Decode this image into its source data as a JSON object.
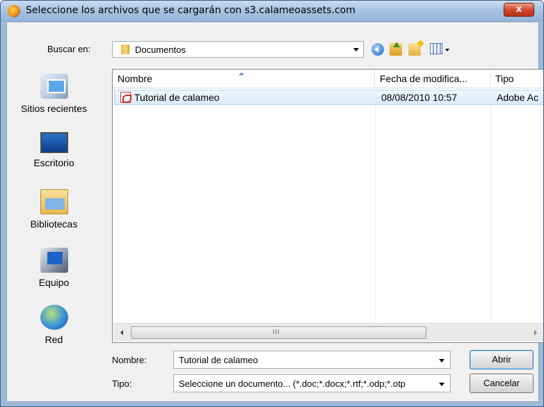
{
  "window": {
    "title": "Seleccione los archivos que se cargarán con s3.calameoassets.com",
    "close_label": "x"
  },
  "lookin": {
    "label": "Buscar en:",
    "value": "Documentos"
  },
  "toolbar": {
    "icons": [
      "back-icon",
      "up-folder-icon",
      "new-folder-icon",
      "views-icon"
    ]
  },
  "places": [
    {
      "label": "Sitios recientes",
      "icon": "recent-places-icon"
    },
    {
      "label": "Escritorio",
      "icon": "desktop-icon"
    },
    {
      "label": "Bibliotecas",
      "icon": "libraries-icon"
    },
    {
      "label": "Equipo",
      "icon": "computer-icon"
    },
    {
      "label": "Red",
      "icon": "network-icon"
    }
  ],
  "filelist": {
    "columns": [
      "Nombre",
      "Fecha de modifica...",
      "Tipo"
    ],
    "rows": [
      {
        "name": "Tutorial de calameo",
        "date": "08/08/2010 10:57",
        "type": "Adobe Ac",
        "icon": "pdf-icon"
      }
    ],
    "scroll_grip": "III"
  },
  "filename": {
    "label": "Nombre:",
    "value": "Tutorial de calameo"
  },
  "filetype": {
    "label": "Tipo:",
    "value": "Seleccione un documento... (*.doc;*.docx;*.rtf;*.odp;*.otp"
  },
  "buttons": {
    "open": "Abrir",
    "cancel": "Cancelar"
  }
}
